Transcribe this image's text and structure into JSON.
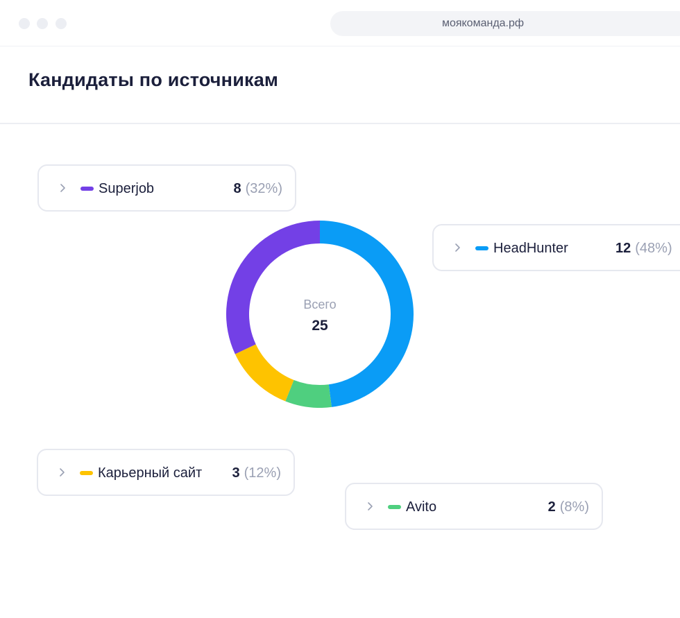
{
  "window": {
    "url": "моякоманда.рф"
  },
  "page": {
    "title": "Кандидаты по источникам"
  },
  "summary": {
    "label": "Всего",
    "total": "25"
  },
  "colors": {
    "superjob": "#7340e6",
    "headhunter": "#0a9cf6",
    "career_site": "#fec300",
    "avito": "#4fcf7f"
  },
  "sources": [
    {
      "name": "Superjob",
      "count": "8",
      "percent": "(32%)",
      "color": "#7340e6",
      "icon": "chevron-right-icon"
    },
    {
      "name": "HeadHunter",
      "count": "12",
      "percent": "(48%)",
      "color": "#0a9cf6",
      "icon": "chevron-right-icon"
    },
    {
      "name": "Карьерный сайт",
      "count": "3",
      "percent": "(12%)",
      "color": "#fec300",
      "icon": "chevron-right-icon"
    },
    {
      "name": "Avito",
      "count": "2",
      "percent": "(8%)",
      "color": "#4fcf7f",
      "icon": "chevron-right-icon"
    }
  ],
  "chart_data": {
    "type": "pie",
    "categories": [
      "HeadHunter",
      "Avito",
      "Карьерный сайт",
      "Superjob"
    ],
    "values": [
      12,
      2,
      3,
      8
    ],
    "colors": [
      "#0a9cf6",
      "#4fcf7f",
      "#fec300",
      "#7340e6"
    ],
    "donut": true,
    "start": "top, clockwise",
    "title": "",
    "center_label": "Всего",
    "center_value": "25"
  }
}
